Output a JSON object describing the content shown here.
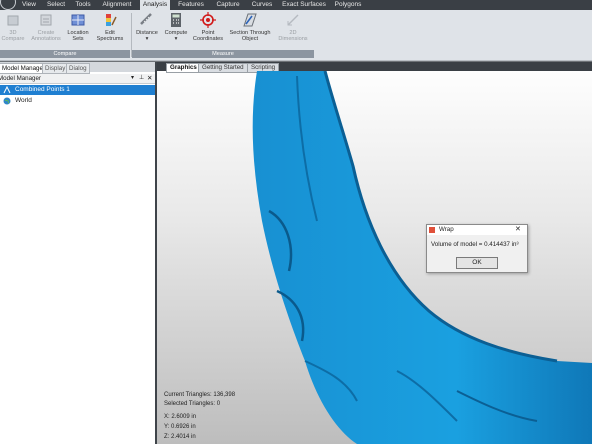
{
  "menubar": {
    "items": [
      "View",
      "Select",
      "Tools",
      "Alignment",
      "Analysis",
      "Features",
      "Capture",
      "Curves",
      "Exact Surfaces",
      "Polygons"
    ],
    "active": "Analysis"
  },
  "ribbon": {
    "buttons": [
      {
        "label": "3D\nCompare",
        "icon": "3d-compare-icon"
      },
      {
        "label": "Create\nAnnotations",
        "icon": "annotations-icon"
      },
      {
        "label": "Location\nSets",
        "icon": "location-sets-icon"
      },
      {
        "label": "Edit\nSpectrums",
        "icon": "edit-spectrums-icon"
      },
      {
        "label": "Distance",
        "icon": "ruler-icon"
      },
      {
        "label": "Compute",
        "icon": "calculator-icon"
      },
      {
        "label": "Point\nCoordinates",
        "icon": "crosshair-icon"
      },
      {
        "label": "Section Through\nObject",
        "icon": "section-icon"
      },
      {
        "label": "2D\nDimensions",
        "icon": "2d-dimensions-icon"
      }
    ],
    "groups": {
      "compare": "Compare",
      "measure": "Measure"
    }
  },
  "left_panel": {
    "tabs": [
      "Model Manager",
      "Display",
      "Dialog"
    ],
    "header": "Model Manager",
    "tree": [
      "Combined Points 1",
      "World"
    ]
  },
  "viewport": {
    "tabs": [
      "Graphics",
      "Getting Started",
      "Scripting"
    ],
    "status": {
      "current_triangles": "Current Triangles: 136,398",
      "selected_triangles": "Selected Triangles: 0",
      "x": "X: 2.6009 in",
      "y": "Y: 0.6926 in",
      "z": "Z: 2.4014 in"
    }
  },
  "dialog": {
    "title": "Wrap",
    "message": "Volume of model = 0.414437 in³",
    "ok": "OK"
  },
  "colors": {
    "model": "#1a9ad6",
    "selection": "#1f7fd1",
    "menubar": "#3a3f45"
  }
}
